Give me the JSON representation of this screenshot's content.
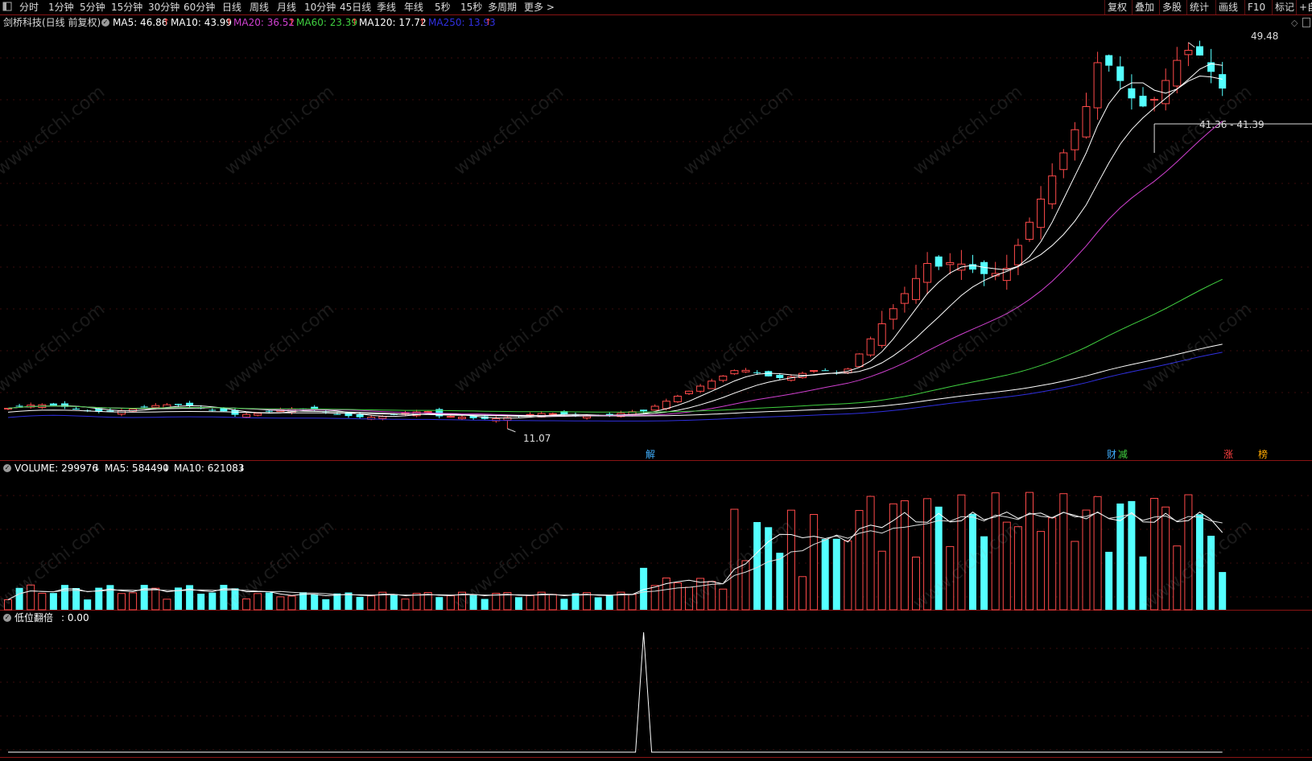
{
  "toolbar": {
    "left_items": [
      "分时",
      "1分钟",
      "5分钟",
      "15分钟",
      "30分钟",
      "60分钟",
      "日线",
      "周线",
      "月线",
      "10分钟",
      "45日线",
      "季线",
      "年线",
      "5秒",
      "15秒",
      "多周期",
      "更多 >"
    ],
    "right_items": [
      "复权",
      "叠加",
      "多股",
      "统计",
      "画线",
      "F10",
      "标记",
      "+自"
    ]
  },
  "main_legend": {
    "title": "剑桥科技(日线 前复权)",
    "ma": [
      {
        "label": "MA5: 46.86",
        "color": "#ffffff"
      },
      {
        "label": "MA10: 43.99",
        "color": "#ffffff"
      },
      {
        "label": "MA20: 36.52",
        "color": "#d040d0"
      },
      {
        "label": "MA60: 23.39",
        "color": "#40d040"
      },
      {
        "label": "MA120: 17.72",
        "color": "#ffffff"
      },
      {
        "label": "MA250: 13.93",
        "color": "#3030e0"
      }
    ],
    "arrow_up": "↑"
  },
  "price_labels": {
    "high": "49.48",
    "low": "11.07",
    "range": "41.36 - 41.39"
  },
  "event_tags": [
    {
      "text": "解",
      "color": "#40b0ff"
    },
    {
      "text": "财",
      "color": "#40b0ff"
    },
    {
      "text": "减",
      "color": "#40d040"
    },
    {
      "text": "涨",
      "color": "#ff4040"
    },
    {
      "text": "榜",
      "color": "#ffaa00"
    }
  ],
  "volume_legend": {
    "volume": "VOLUME: 299976",
    "ma5": "MA5: 584490",
    "ma10": "MA10: 621083",
    "arrow_down": "↓"
  },
  "indicator_legend": {
    "name": "低位翻倍",
    "value": ": 0.00"
  },
  "watermark": "www.cfchi.com",
  "colors": {
    "up": "#ff4a4a",
    "down": "#54ffff",
    "ma5": "#ffffff",
    "ma10": "#ffffff",
    "ma20": "#d040d0",
    "ma60": "#40d040",
    "ma120": "#ffffff",
    "ma250": "#3030e0",
    "divider": "#8a1414"
  },
  "chart_data": {
    "type": "candlestick",
    "title": "剑桥科技(日线 前复权)",
    "price_high": 49.48,
    "price_low": 11.07,
    "last_ma": {
      "MA5": 46.86,
      "MA10": 43.99,
      "MA20": 36.52,
      "MA60": 23.39,
      "MA120": 17.72,
      "MA250": 13.93
    },
    "last_volume": 299976,
    "volume_ma": {
      "MA5": 584490,
      "MA10": 621083
    },
    "indicator": {
      "name": "低位翻倍",
      "value": 0.0,
      "peak_value": 1
    }
  }
}
